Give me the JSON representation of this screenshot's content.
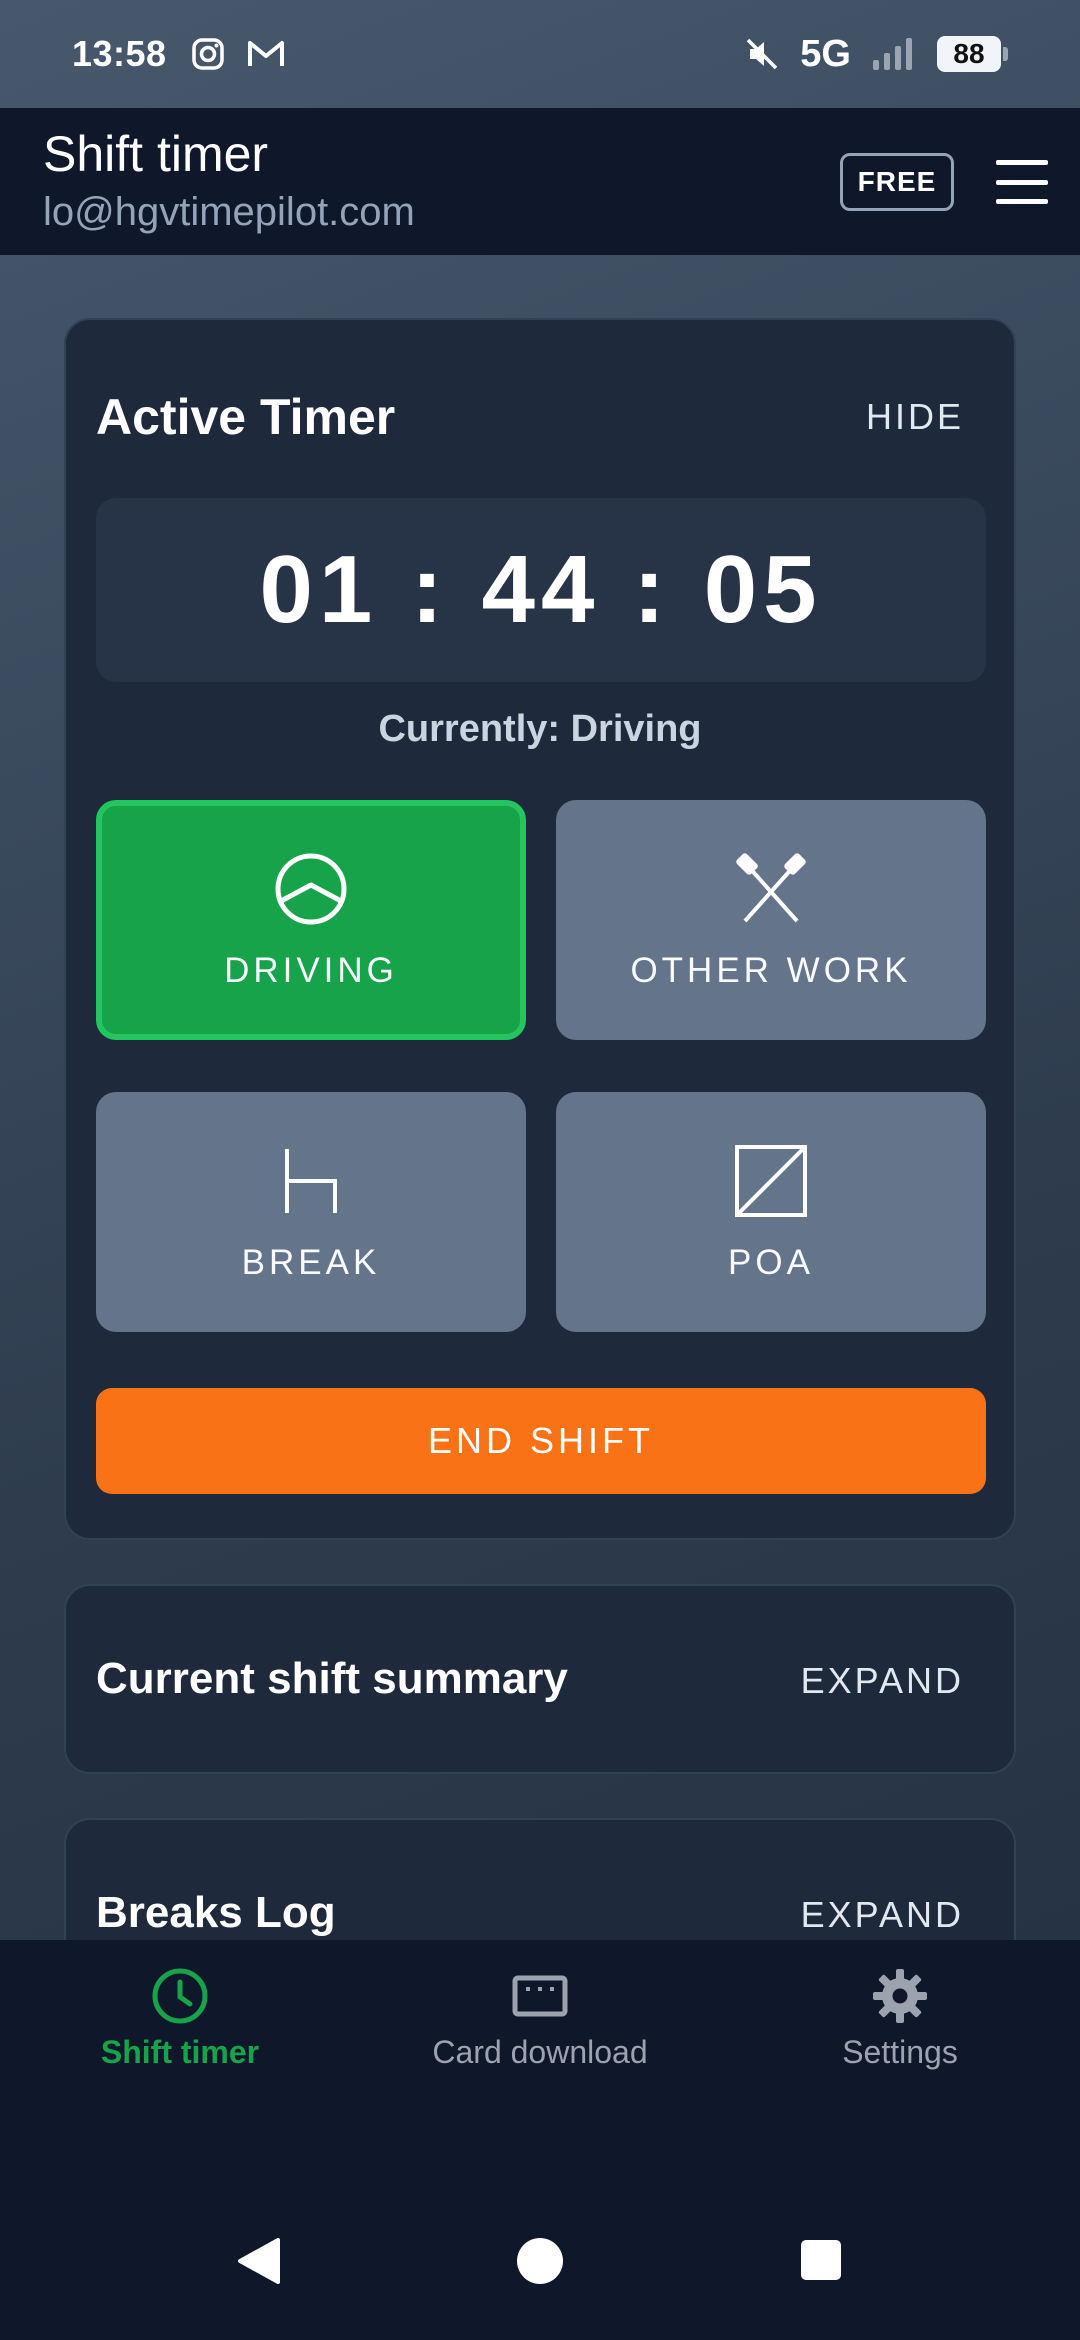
{
  "status_bar": {
    "time": "13:58",
    "network": "5G",
    "battery": "88"
  },
  "header": {
    "title": "Shift timer",
    "email": "lo@hgvtimepilot.com",
    "plan_badge": "FREE"
  },
  "active_timer": {
    "title": "Active Timer",
    "hide_label": "HIDE",
    "elapsed": "01 : 44 : 05",
    "currently": "Currently: Driving",
    "modes": [
      {
        "label": "DRIVING",
        "icon": "steering-wheel-icon",
        "active": true
      },
      {
        "label": "OTHER WORK",
        "icon": "crossed-hammers-icon",
        "active": false
      },
      {
        "label": "BREAK",
        "icon": "bed-icon",
        "active": false
      },
      {
        "label": "POA",
        "icon": "poa-square-icon",
        "active": false
      }
    ],
    "end_shift_label": "END SHIFT"
  },
  "summary": {
    "title": "Current shift summary",
    "action": "EXPAND"
  },
  "breaks_log": {
    "title": "Breaks Log",
    "action": "EXPAND"
  },
  "bottom_nav": [
    {
      "label": "Shift timer",
      "icon": "clock-icon",
      "active": true
    },
    {
      "label": "Card download",
      "icon": "card-reader-icon",
      "active": false
    },
    {
      "label": "Settings",
      "icon": "gear-icon",
      "active": false
    }
  ],
  "colors": {
    "active_green": "#16a34a",
    "end_shift_orange": "#f97316",
    "mode_inactive": "#64748b"
  }
}
